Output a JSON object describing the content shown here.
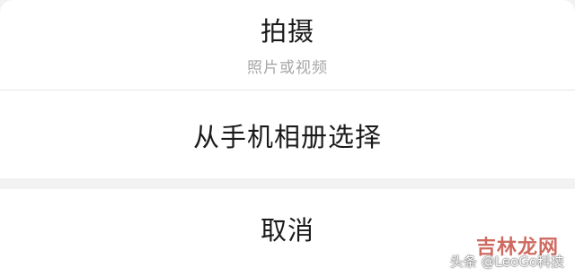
{
  "action_sheet": {
    "camera": {
      "label": "拍摄",
      "sublabel": "照片或视频"
    },
    "album": {
      "label": "从手机相册选择"
    },
    "cancel": {
      "label": "取消"
    }
  },
  "watermarks": {
    "site": "吉林龙网",
    "source": "头条 @LeoGo科技"
  },
  "colors": {
    "sheet_bg": "#ffffff",
    "separator_bg": "#f2f2f2",
    "primary_text": "#1a1a1a",
    "secondary_text": "#a6a6a6",
    "watermark_red": "#c0392b"
  }
}
